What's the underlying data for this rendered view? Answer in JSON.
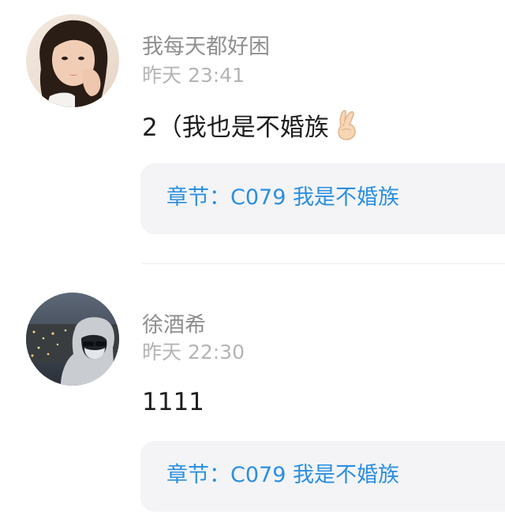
{
  "comments": [
    {
      "username": "我每天都好困",
      "timestamp": "昨天 23:41",
      "text": "2（我也是不婚族",
      "emoji_icon": "crossed-fingers-icon",
      "chapter": "章节：C079 我是不婚族"
    },
    {
      "username": "徐酒希",
      "timestamp": "昨天 22:30",
      "text": "1111",
      "chapter": "章节：C079 我是不婚族"
    }
  ],
  "colors": {
    "username": "#8f8f8f",
    "timestamp": "#b4b4b4",
    "text": "#1e1e1e",
    "link": "#2b8fe0",
    "chapter_bg": "#f4f4f6"
  }
}
